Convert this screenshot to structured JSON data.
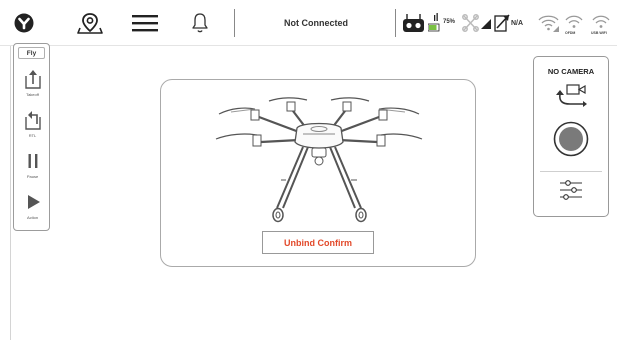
{
  "topbar": {
    "connection_status": "Not Connected",
    "battery_percent": "75%",
    "na_text": "N/A",
    "ofdm_label": "OFDM",
    "usb_wifi_label": "USB WIFI",
    "icons": [
      "yuneec-logo-icon",
      "map-pin-icon",
      "menu-icon",
      "bell-icon",
      "remote-controller-icon",
      "battery-icon",
      "drone-signal-icon",
      "signal-bars-icon",
      "gps-icon",
      "wifi-icon",
      "wifi-icon"
    ]
  },
  "fly_panel": {
    "title": "Fly",
    "items": [
      {
        "label": "Takeoff",
        "icon": "takeoff-icon"
      },
      {
        "label": "RTL",
        "icon": "return-home-icon"
      },
      {
        "label": "Pause",
        "icon": "pause-icon"
      },
      {
        "label": "Action",
        "icon": "play-icon"
      }
    ]
  },
  "main_card": {
    "button_label": "Unbind Confirm",
    "accent_color": "#e2492a",
    "image": "hexacopter-drone"
  },
  "camera_panel": {
    "title": "NO CAMERA",
    "icons": [
      "switch-camera-icon",
      "record-button-icon",
      "camera-settings-icon"
    ]
  }
}
